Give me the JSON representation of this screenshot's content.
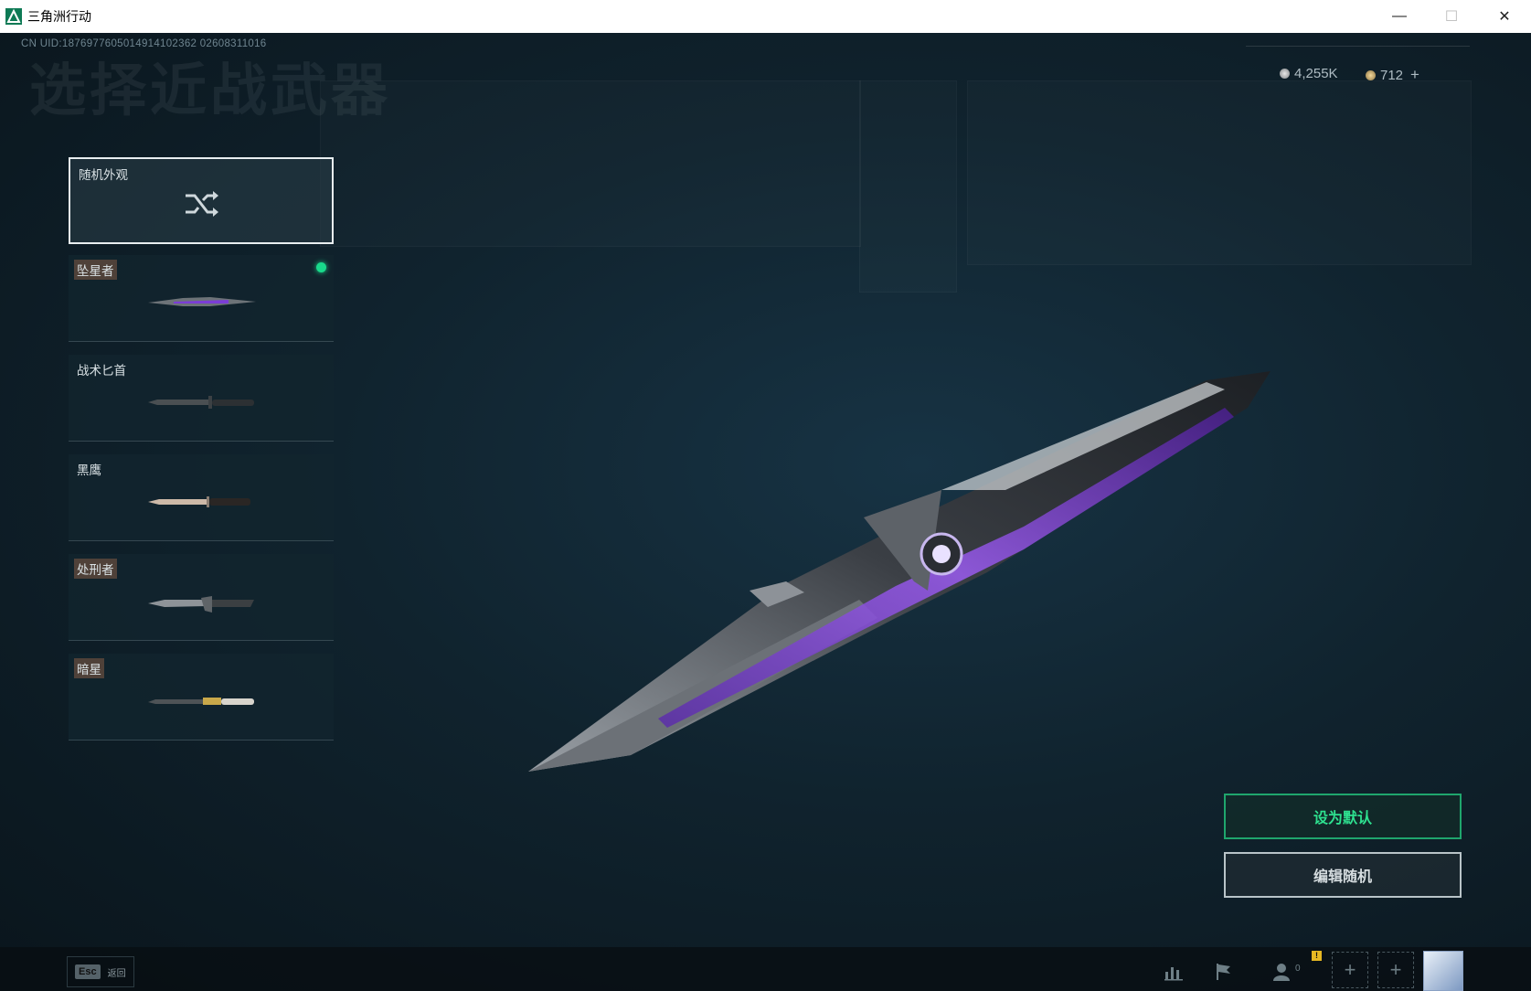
{
  "window": {
    "title": "三角洲行动",
    "minimize": "—",
    "maximize": "☐",
    "close": "✕"
  },
  "header": {
    "uid": "CN UID:1876977605014914102362 02608311016",
    "page_title": "选择近战武器"
  },
  "currency": {
    "coins": "4,255K",
    "tickets": "712",
    "add": "+"
  },
  "cards": [
    {
      "label": "随机外观",
      "type": "random"
    },
    {
      "label": "坠星者",
      "selected": true
    },
    {
      "label": "战术匕首"
    },
    {
      "label": "黑鹰"
    },
    {
      "label": "处刑者"
    },
    {
      "label": "暗星"
    }
  ],
  "actions": {
    "set_default": "设为默认",
    "edit_random": "编辑随机"
  },
  "bottom": {
    "esc_key": "Esc",
    "esc_label": "返回",
    "friends_count": "0",
    "warning": "!",
    "plus": "+"
  },
  "colors": {
    "accent_green": "#19d98b",
    "knife_purple": "#7b3dd6"
  }
}
